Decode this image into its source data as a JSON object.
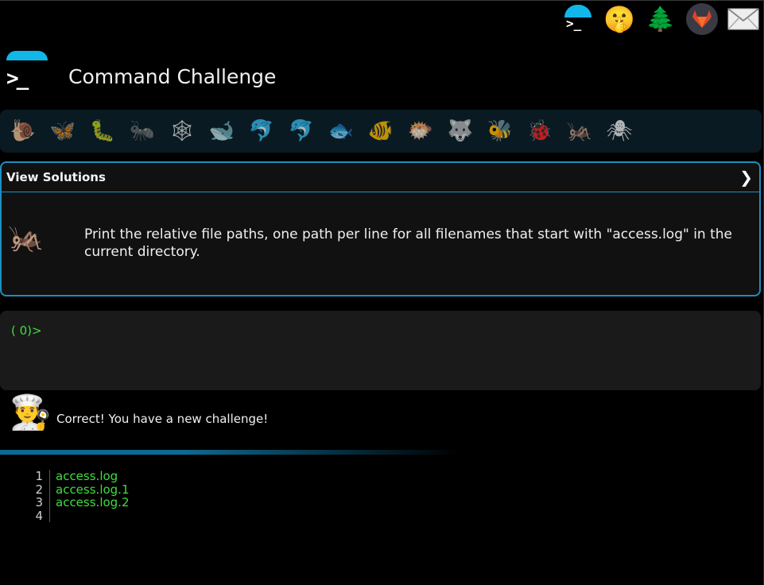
{
  "app": {
    "title": "Command Challenge",
    "prompt_glyph": ">_"
  },
  "topnav": {
    "icons": [
      {
        "name": "cmdchallenge-logo-icon",
        "glyph": ">_"
      },
      {
        "name": "shushing-face-icon",
        "glyph": "🤫"
      },
      {
        "name": "evergreen-tree-icon",
        "glyph": "🌲"
      },
      {
        "name": "gitlab-icon",
        "glyph": "🦊"
      },
      {
        "name": "envelope-icon",
        "glyph": "✉"
      }
    ]
  },
  "levels": [
    {
      "name": "snail",
      "glyph": "🐌"
    },
    {
      "name": "butterfly",
      "glyph": "🦋"
    },
    {
      "name": "caterpillar",
      "glyph": "🐛"
    },
    {
      "name": "ant",
      "glyph": "🐜"
    },
    {
      "name": "spider-web",
      "glyph": "🕸"
    },
    {
      "name": "whale",
      "glyph": "🐋"
    },
    {
      "name": "dolphin-blue",
      "glyph": "🐬"
    },
    {
      "name": "dolphin",
      "glyph": "🐬"
    },
    {
      "name": "fish",
      "glyph": "🐟"
    },
    {
      "name": "tropical-fish",
      "glyph": "🐠"
    },
    {
      "name": "blowfish",
      "glyph": "🐡"
    },
    {
      "name": "wolf",
      "glyph": "🐺"
    },
    {
      "name": "bee",
      "glyph": "🐝"
    },
    {
      "name": "ladybug",
      "glyph": "🐞"
    },
    {
      "name": "cricket",
      "glyph": "🦗"
    },
    {
      "name": "spider",
      "glyph": "🕷"
    }
  ],
  "challenge": {
    "header": "View Solutions",
    "chevron": "❯",
    "icon": "🦗",
    "description": "Print the relative file paths, one path per line for all filenames that start with \"access.log\" in the current directory."
  },
  "terminal": {
    "prompt": "( 0)>",
    "value": ""
  },
  "message": {
    "icon": "👨‍🍳",
    "text": "Correct! You have a new challenge!"
  },
  "output": {
    "lines": [
      {
        "num": "1",
        "text": "access.log"
      },
      {
        "num": "2",
        "text": "access.log.1"
      },
      {
        "num": "3",
        "text": "access.log.2"
      },
      {
        "num": "4",
        "text": ""
      }
    ]
  },
  "colors": {
    "accent": "#11b7e9",
    "border": "#1c8fc2",
    "output_green": "#3fdd3f",
    "background": "#000000"
  }
}
